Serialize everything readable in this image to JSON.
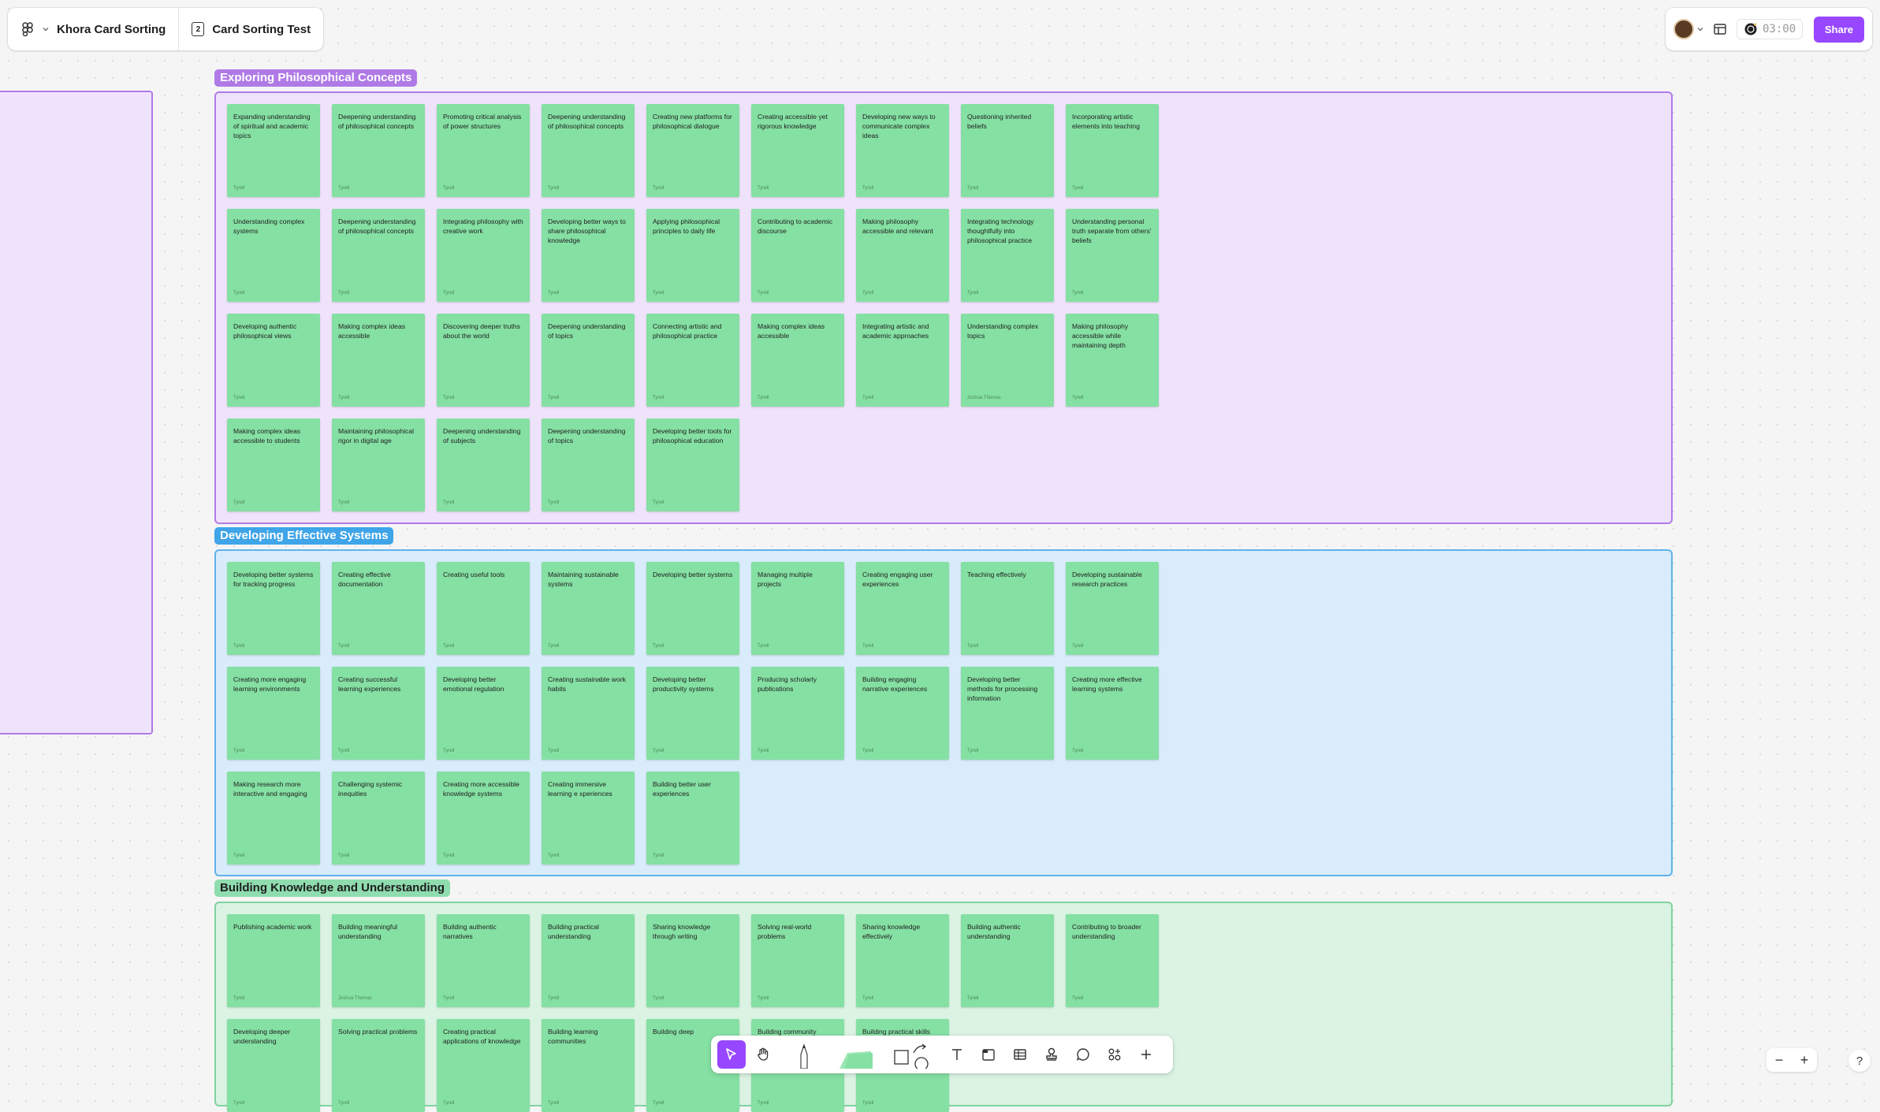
{
  "header": {
    "file_title": "Khora Card Sorting",
    "page_badge": "2",
    "page_title": "Card Sorting Test"
  },
  "right_bar": {
    "timer": "03:00",
    "share_label": "Share"
  },
  "colors": {
    "card": "#85e0a3",
    "accent": "#9747ff"
  },
  "sections": [
    {
      "title": "Exploring Philosophical Concepts",
      "label_bg": "#b07ae6",
      "label_fg": "#ffffff",
      "border": "#b07ae6",
      "fill": "#efe3fb",
      "cards": [
        {
          "text": "Expanding understanding of spiritual and academic topics",
          "author": "Tyrell"
        },
        {
          "text": "Deepening understanding of philosophical concepts",
          "author": "Tyrell"
        },
        {
          "text": "Promoting critical analysis of power structures",
          "author": "Tyrell"
        },
        {
          "text": "Deepening understanding of philosophical concepts",
          "author": "Tyrell"
        },
        {
          "text": "Creating new platforms for philosophical dialogue",
          "author": "Tyrell"
        },
        {
          "text": "Creating accessible yet rigorous knowledge",
          "author": "Tyrell"
        },
        {
          "text": "Developing new ways to communicate complex ideas",
          "author": "Tyrell"
        },
        {
          "text": "Questioning inherited beliefs",
          "author": "Tyrell"
        },
        {
          "text": "Incorporating artistic elements into teaching",
          "author": "Tyrell"
        },
        {
          "text": "Understanding complex systems",
          "author": "Tyrell"
        },
        {
          "text": "Deepening understanding of philosophical concepts",
          "author": "Tyrell"
        },
        {
          "text": "Integrating philosophy with creative work",
          "author": "Tyrell"
        },
        {
          "text": "Developing better ways to share philosophical knowledge",
          "author": "Tyrell"
        },
        {
          "text": "Applying philosophical principles to daily life",
          "author": "Tyrell"
        },
        {
          "text": "Contributing to academic discourse",
          "author": "Tyrell"
        },
        {
          "text": "Making philosophy accessible and relevant",
          "author": "Tyrell"
        },
        {
          "text": "Integrating technology thoughtfully into philosophical practice",
          "author": "Tyrell"
        },
        {
          "text": "Understanding personal truth separate from others' beliefs",
          "author": "Tyrell"
        },
        {
          "text": "Developing authentic philosophical views",
          "author": "Tyrell"
        },
        {
          "text": "Making complex ideas accessible",
          "author": "Tyrell"
        },
        {
          "text": "Discovering deeper truths about the world",
          "author": "Tyrell"
        },
        {
          "text": "Deepening understanding of topics",
          "author": "Tyrell"
        },
        {
          "text": "Connecting artistic and philosophical practice",
          "author": "Tyrell"
        },
        {
          "text": "Making complex ideas accessible",
          "author": "Tyrell"
        },
        {
          "text": "Integrating artistic and academic approaches",
          "author": "Tyrell"
        },
        {
          "text": "Understanding complex topics",
          "author": "Joshua Thomas"
        },
        {
          "text": "Making philosophy accessible while maintaining depth",
          "author": "Tyrell"
        },
        {
          "text": "Making complex ideas accessible to students",
          "author": "Tyrell"
        },
        {
          "text": "Maintaining philosophical rigor in digital age",
          "author": "Tyrell"
        },
        {
          "text": "Deepening understanding of subjects",
          "author": "Tyrell"
        },
        {
          "text": "Deepening understanding of topics",
          "author": "Tyrell"
        },
        {
          "text": "Developing better tools for philosophical education",
          "author": "Tyrell"
        }
      ]
    },
    {
      "title": "Developing Effective Systems",
      "label_bg": "#3fa4e8",
      "label_fg": "#ffffff",
      "border": "#5fb2ec",
      "fill": "#d8ecfb",
      "cards": [
        {
          "text": "Developing better systems for tracking progress",
          "author": "Tyrell"
        },
        {
          "text": "Creating effective documentation",
          "author": "Tyrell"
        },
        {
          "text": "Creating useful tools",
          "author": "Tyrell"
        },
        {
          "text": "Maintaining sustainable systems",
          "author": "Tyrell"
        },
        {
          "text": "Developing better systems",
          "author": "Tyrell"
        },
        {
          "text": "Managing multiple projects",
          "author": "Tyrell"
        },
        {
          "text": "Creating engaging user experiences",
          "author": "Tyrell"
        },
        {
          "text": "Teaching effectively",
          "author": "Tyrell"
        },
        {
          "text": "Developing sustainable research practices",
          "author": "Tyrell"
        },
        {
          "text": "Creating more engaging learning environments",
          "author": "Tyrell"
        },
        {
          "text": "Creating successful learning experiences",
          "author": "Tyrell"
        },
        {
          "text": "Developing better emotional regulation",
          "author": "Tyrell"
        },
        {
          "text": "Creating sustainable work habits",
          "author": "Tyrell"
        },
        {
          "text": "Developing better productivity systems",
          "author": "Tyrell"
        },
        {
          "text": "Producing scholarly publications",
          "author": "Tyrell"
        },
        {
          "text": "Building engaging narrative experiences",
          "author": "Tyrell"
        },
        {
          "text": "Developing better methods for processing information",
          "author": "Tyrell"
        },
        {
          "text": "Creating more effective learning systems",
          "author": "Tyrell"
        },
        {
          "text": "Making research more interactive and engaging",
          "author": "Tyrell"
        },
        {
          "text": "Challenging systemic inequities",
          "author": "Tyrell"
        },
        {
          "text": "Creating more accessible knowledge systems",
          "author": "Tyrell"
        },
        {
          "text": "Creating immersive learning e xperiences",
          "author": "Tyrell"
        },
        {
          "text": "Building better user experiences",
          "author": "Tyrell"
        }
      ]
    },
    {
      "title": "Building Knowledge and Understanding",
      "label_bg": "#8fdcae",
      "label_fg": "#1e1e1e",
      "border": "#7fd3a0",
      "fill": "#daf3e3",
      "cards": [
        {
          "text": "Publishing academic work",
          "author": "Tyrell"
        },
        {
          "text": "Building meaningful understanding",
          "author": "Joshua Thomas"
        },
        {
          "text": "Building authentic narratives",
          "author": "Tyrell"
        },
        {
          "text": "Building practical understanding",
          "author": "Tyrell"
        },
        {
          "text": "Sharing knowledge through writing",
          "author": "Tyrell"
        },
        {
          "text": "Solving real-world problems",
          "author": "Tyrell"
        },
        {
          "text": "Sharing knowledge effectively",
          "author": "Tyrell"
        },
        {
          "text": "Building authentic understanding",
          "author": "Tyrell"
        },
        {
          "text": "Contributing to broader understanding",
          "author": "Tyrell"
        },
        {
          "text": "Developing deeper understanding",
          "author": "Tyrell"
        },
        {
          "text": "Solving practical problems",
          "author": "Tyrell"
        },
        {
          "text": "Creating practical applications of knowledge",
          "author": "Tyrell"
        },
        {
          "text": "Building learning communities",
          "author": "Tyrell"
        },
        {
          "text": "Building deep",
          "author": "Tyrell"
        },
        {
          "text": "Building community",
          "author": "Tyrell"
        },
        {
          "text": "Building practical skills",
          "author": "Tyrell"
        }
      ]
    }
  ],
  "toolbar": {
    "tools": [
      "move-tool",
      "hand-tool",
      "marker-tool",
      "sticky-tool",
      "shape-tool",
      "connector-tool",
      "text-tool",
      "section-tool",
      "table-tool",
      "stamp-tool",
      "comment-tool",
      "widgets-tool",
      "more-tool"
    ]
  },
  "zoom": {
    "out": "−",
    "in": "+"
  },
  "help_label": "?"
}
